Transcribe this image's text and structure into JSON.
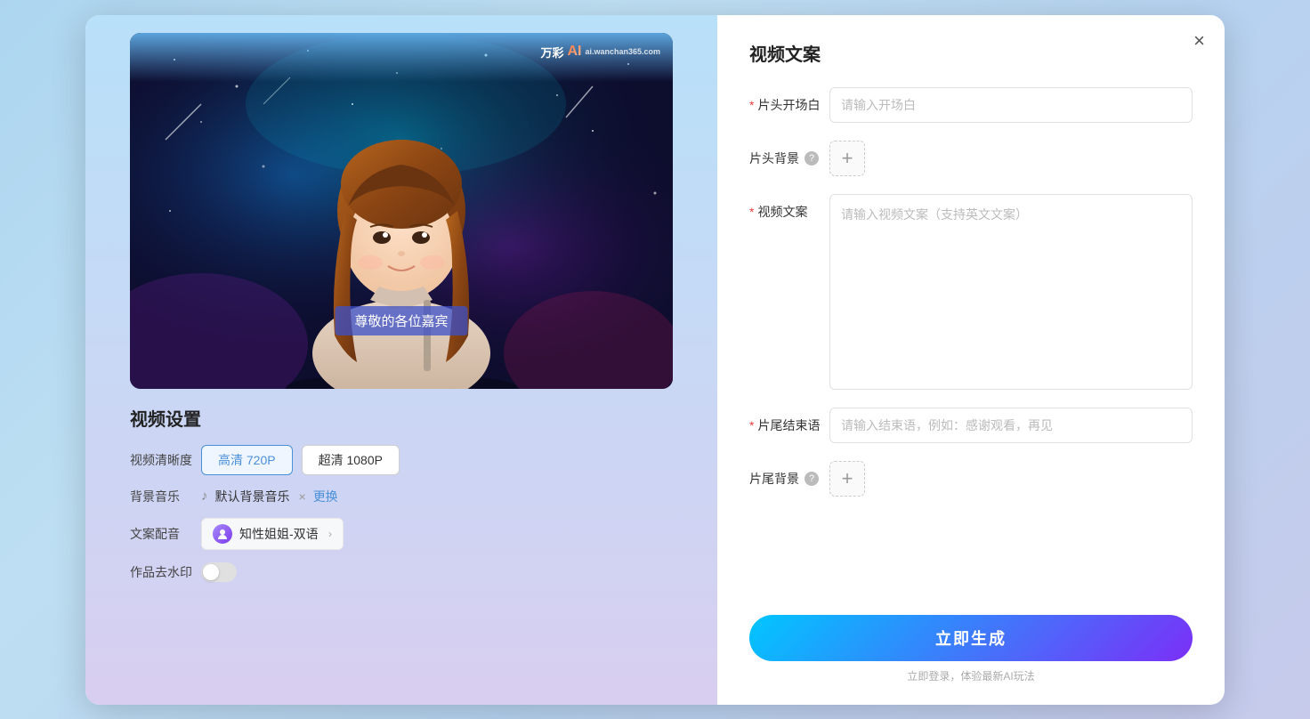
{
  "modal": {
    "close_label": "×",
    "left": {
      "video_preview": {
        "watermark_brand": "万彩",
        "watermark_ai": "AI",
        "watermark_sub": "ai.wanchan365.com",
        "subtitle_text": "尊敬的各位嘉宾"
      },
      "settings": {
        "title": "视频设置",
        "clarity_label": "视频清晰度",
        "clarity_options": [
          {
            "label": "高清 720P",
            "active": true
          },
          {
            "label": "超清 1080P",
            "active": false
          }
        ],
        "music_label": "背景音乐",
        "music_name": "默认背景音乐",
        "music_remove": "×",
        "music_change": "更换",
        "voice_label": "文案配音",
        "voice_name": "知性姐姐-双语",
        "watermark_label": "作品去水印"
      }
    },
    "right": {
      "title": "视频文案",
      "form": {
        "opening_label": "片头开场白",
        "opening_required": "*",
        "opening_placeholder": "请输入开场白",
        "header_bg_label": "片头背景",
        "header_bg_add": "+",
        "content_label": "视频文案",
        "content_required": "*",
        "content_placeholder": "请输入视频文案（支持英文文案）",
        "closing_label": "片尾结束语",
        "closing_required": "*",
        "closing_placeholder": "请输入结束语，例如：感谢观看，再见",
        "footer_bg_label": "片尾背景",
        "footer_bg_add": "+"
      },
      "generate_btn": "立即生成",
      "login_hint": "立即登录，体验最新AI玩法"
    }
  }
}
